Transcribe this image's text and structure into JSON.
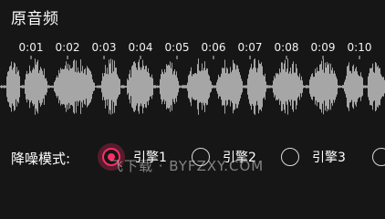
{
  "title": "原音频",
  "timeline": {
    "ticks": [
      "0:01",
      "0:02",
      "0:03",
      "0:04",
      "0:05",
      "0:06",
      "0:07",
      "0:08",
      "0:09",
      "0:10"
    ]
  },
  "waveform": {
    "color": "#a6a6a6"
  },
  "mode": {
    "label": "降噪模式:",
    "options": [
      {
        "label": "引擎1",
        "selected": true
      },
      {
        "label": "引擎2",
        "selected": false
      },
      {
        "label": "引擎3",
        "selected": false
      }
    ],
    "accent_color": "#ff2d6a"
  },
  "watermark": "飞下载 · BYFZXY.COM"
}
